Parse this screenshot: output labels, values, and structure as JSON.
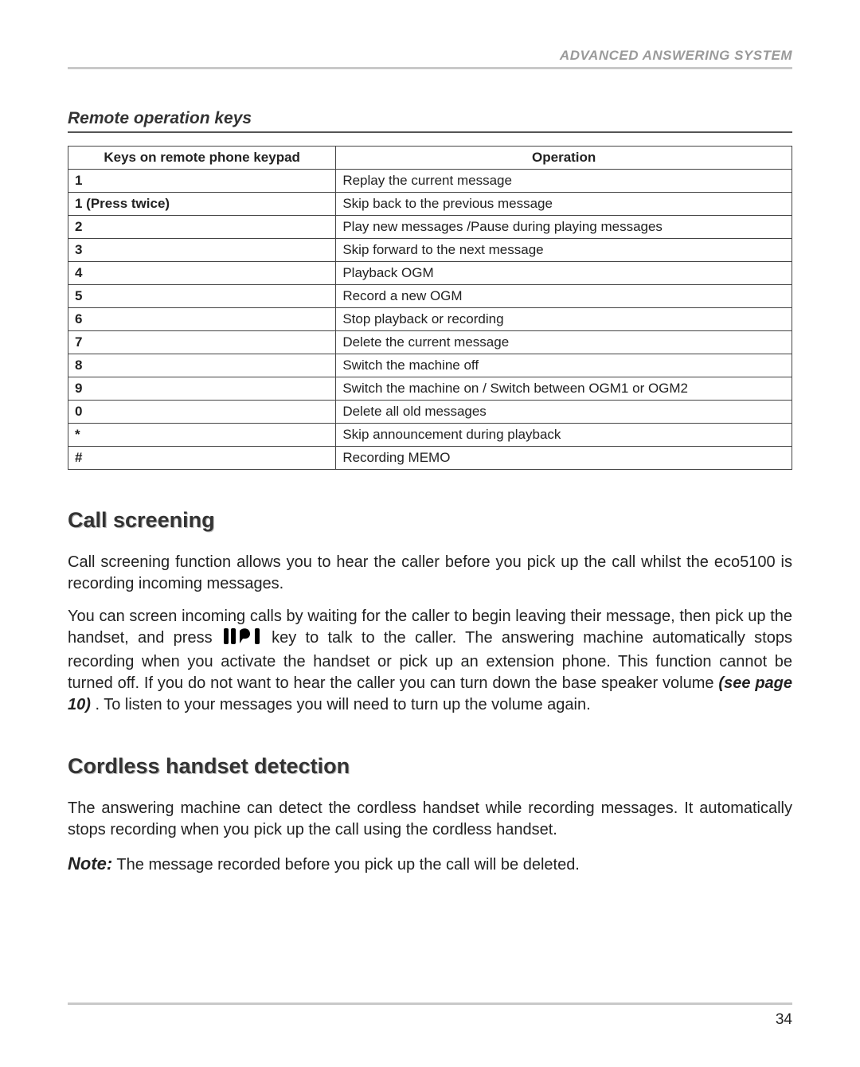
{
  "header": "ADVANCED ANSWERING SYSTEM",
  "subheader": "Remote operation keys",
  "table": {
    "head_key": "Keys on remote phone keypad",
    "head_op": "Operation",
    "rows": [
      {
        "key": "1",
        "op": "Replay the current message"
      },
      {
        "key": "1 (Press twice)",
        "op": "Skip back to the previous message"
      },
      {
        "key": "2",
        "op": "Play new messages /Pause during playing messages"
      },
      {
        "key": "3",
        "op": "Skip forward to the next message"
      },
      {
        "key": "4",
        "op": "Playback OGM"
      },
      {
        "key": "5",
        "op": "Record a new OGM"
      },
      {
        "key": "6",
        "op": "Stop playback or recording"
      },
      {
        "key": "7",
        "op": "Delete the current message"
      },
      {
        "key": "8",
        "op": "Switch the machine off"
      },
      {
        "key": "9",
        "op": "Switch the machine on / Switch between OGM1 or OGM2"
      },
      {
        "key": "0",
        "op": "Delete all old messages"
      },
      {
        "key": "*",
        "op": "Skip announcement during playback"
      },
      {
        "key": "#",
        "op": "Recording MEMO"
      }
    ]
  },
  "section1_title": "Call screening",
  "para1": "Call screening function allows you to hear the caller before you pick up the call whilst the eco5100 is recording incoming messages.",
  "para2a": "You can screen incoming calls by waiting for the caller to begin leaving their message, then pick up the handset, and press ",
  "para2b": " key to talk to the caller. The answering machine automatically stops recording when you activate the handset or pick up an extension phone. This function cannot be turned off. If you do not want to hear the caller you can turn down the base speaker volume ",
  "see_page": "(see page 10)",
  "para2c": ". To listen to your messages you will need to turn up the volume again.",
  "section2_title": "Cordless handset detection",
  "para3": "The answering machine can detect the cordless handset while recording messages. It automatically stops recording when you pick up the call using the cordless handset.",
  "note_label": "Note:",
  "note_text": " The message recorded before you pick up the call will be deleted.",
  "page_number": "34",
  "icon_name": "talk-key-icon"
}
